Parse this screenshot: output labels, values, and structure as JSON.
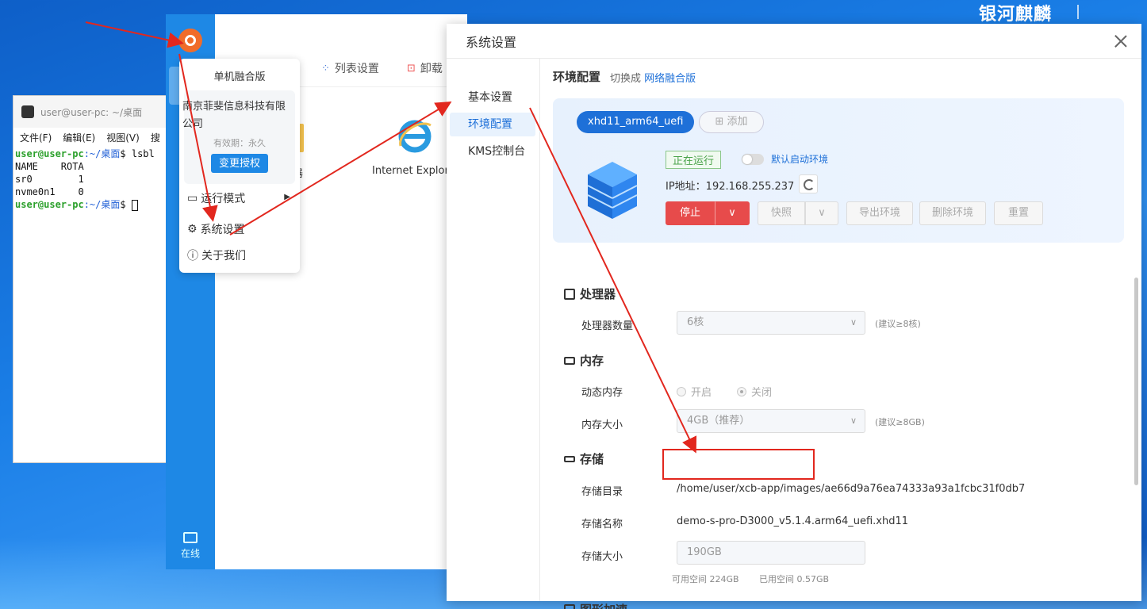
{
  "brand": "银河麒麟",
  "terminal": {
    "title": "user@user-pc: ~/桌面",
    "menu": [
      "文件(F)",
      "编辑(E)",
      "视图(V)",
      "搜"
    ],
    "prompt_user": "user@user-pc",
    "prompt_path": ":~/桌面",
    "prompt_cmd": "$ lsbl",
    "lines": [
      "NAME    ROTA",
      "sr0        1",
      "nvme0n1    0"
    ],
    "prompt_end": "$"
  },
  "app": {
    "toolbar": {
      "list_settings": "列表设置",
      "uninstall": "卸载"
    },
    "icon_label_partial": "器",
    "ie_label": "Internet Explore",
    "online_label": "在线"
  },
  "popup": {
    "title": "单机融合版",
    "company": "南京菲斐信息科技有限公司",
    "validity": "有效期：永久",
    "change_license": "变更授权",
    "run_mode": "运行模式",
    "system_settings": "系统设置",
    "about": "关于我们"
  },
  "dialog": {
    "title": "系统设置",
    "nav": [
      "基本设置",
      "环境配置",
      "KMS控制台"
    ],
    "env_title": "环境配置",
    "switch_prefix": "切换成",
    "switch_link": "网络融合版",
    "env_tab": "xhd11_arm64_uefi",
    "add_label": "添加",
    "status": "正在运行",
    "default_boot": "默认启动环境",
    "ip_label": "IP地址：192.168.255.237",
    "buttons": {
      "stop": "停止",
      "snapshot": "快照",
      "export": "导出环境",
      "delete": "删除环境",
      "reset": "重置"
    },
    "cpu": {
      "title": "处理器",
      "count_label": "处理器数量",
      "count_value": "6核",
      "hint": "(建议≥8核)"
    },
    "memory": {
      "title": "内存",
      "dynamic_label": "动态内存",
      "on": "开启",
      "off": "关闭",
      "size_label": "内存大小",
      "size_value": "4GB（推荐）",
      "hint": "(建议≥8GB)"
    },
    "storage": {
      "title": "存储",
      "dir_label": "存储目录",
      "dir_value": "/home/user/xcb-app/images/ae66d9a76ea74333a93a1fcbc31f0db7",
      "name_label": "存储名称",
      "name_value": "demo-s-pro-D3000_v5.1.4.arm64_uefi.xhd11",
      "size_label": "存储大小",
      "size_value": "190GB",
      "available": "可用空间 224GB",
      "used": "已用空间 0.57GB"
    },
    "graphics": {
      "title": "图形加速"
    }
  }
}
